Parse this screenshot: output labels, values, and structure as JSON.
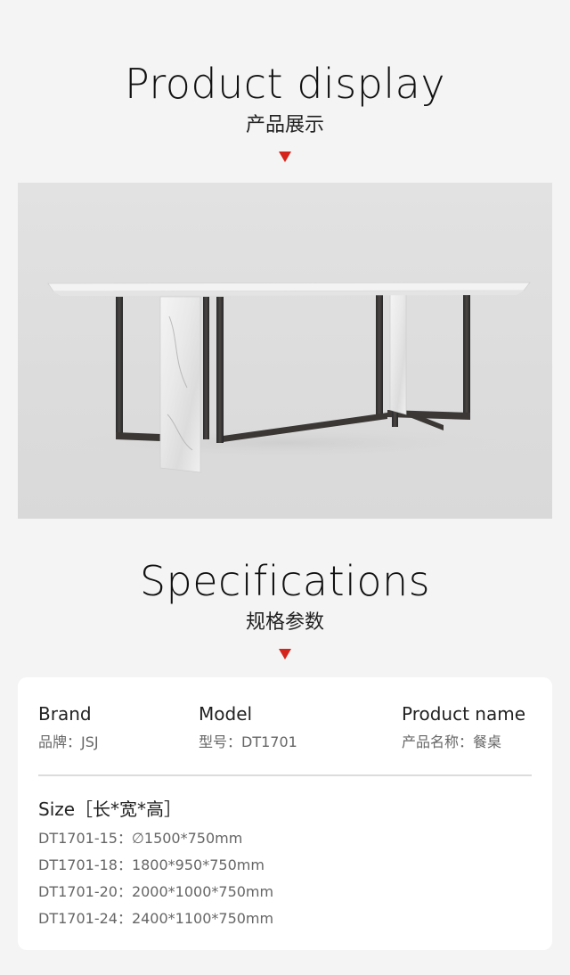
{
  "display": {
    "title_en": "Product display",
    "title_cn": "产品展示"
  },
  "specifications": {
    "title_en": "Specifications",
    "title_cn": "规格参数"
  },
  "card": {
    "brand": {
      "label": "Brand",
      "value": "品牌：JSJ"
    },
    "model": {
      "label": "Model",
      "value": "型号：DT1701"
    },
    "product_name": {
      "label": "Product name",
      "value": "产品名称：餐桌"
    },
    "size_heading": "Size［长*宽*高］",
    "sizes": [
      "DT1701-15：∅1500*750mm",
      "DT1701-18：1800*950*750mm",
      "DT1701-20：2000*1000*750mm",
      "DT1701-24：2400*1100*750mm"
    ]
  },
  "colors": {
    "accent_triangle": "#d4241c",
    "page_background": "#f4f4f4",
    "card_background": "#ffffff"
  }
}
